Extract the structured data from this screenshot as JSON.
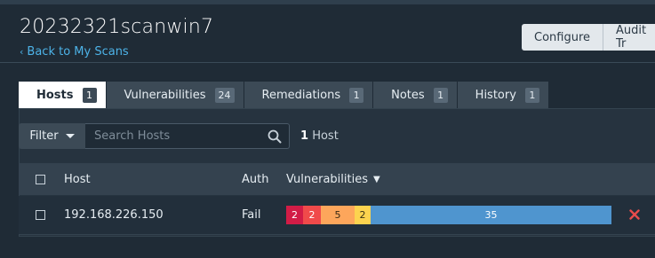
{
  "scan": {
    "title": "20232321scanwin7",
    "back_label": "Back to My Scans"
  },
  "toolbar": {
    "configure_label": "Configure",
    "audit_label": "Audit Tr"
  },
  "tabs": [
    {
      "label": "Hosts",
      "count": "1"
    },
    {
      "label": "Vulnerabilities",
      "count": "24"
    },
    {
      "label": "Remediations",
      "count": "1"
    },
    {
      "label": "Notes",
      "count": "1"
    },
    {
      "label": "History",
      "count": "1"
    }
  ],
  "filter": {
    "label": "Filter",
    "search_placeholder": "Search Hosts",
    "host_count_number": "1",
    "host_count_unit": "Host"
  },
  "table": {
    "headers": {
      "host": "Host",
      "auth": "Auth",
      "vulnerabilities": "Vulnerabilities"
    },
    "rows": [
      {
        "host": "192.168.226.150",
        "auth": "Fail",
        "vuln_counts": {
          "critical": "2",
          "high": "2",
          "medium": "5",
          "low": "2",
          "info": "35"
        }
      }
    ]
  },
  "colors": {
    "critical": "#d21c46",
    "high": "#f04a4a",
    "medium": "#fda65b",
    "low": "#fcd34f",
    "info": "#4f95cf",
    "link": "#4db3e8",
    "remove": "#e84c4c"
  },
  "icons": {
    "back": "chevron-left-icon",
    "filter_dropdown": "caret-down-icon",
    "search": "search-icon",
    "sort": "sort-down-icon",
    "remove": "close-icon"
  }
}
